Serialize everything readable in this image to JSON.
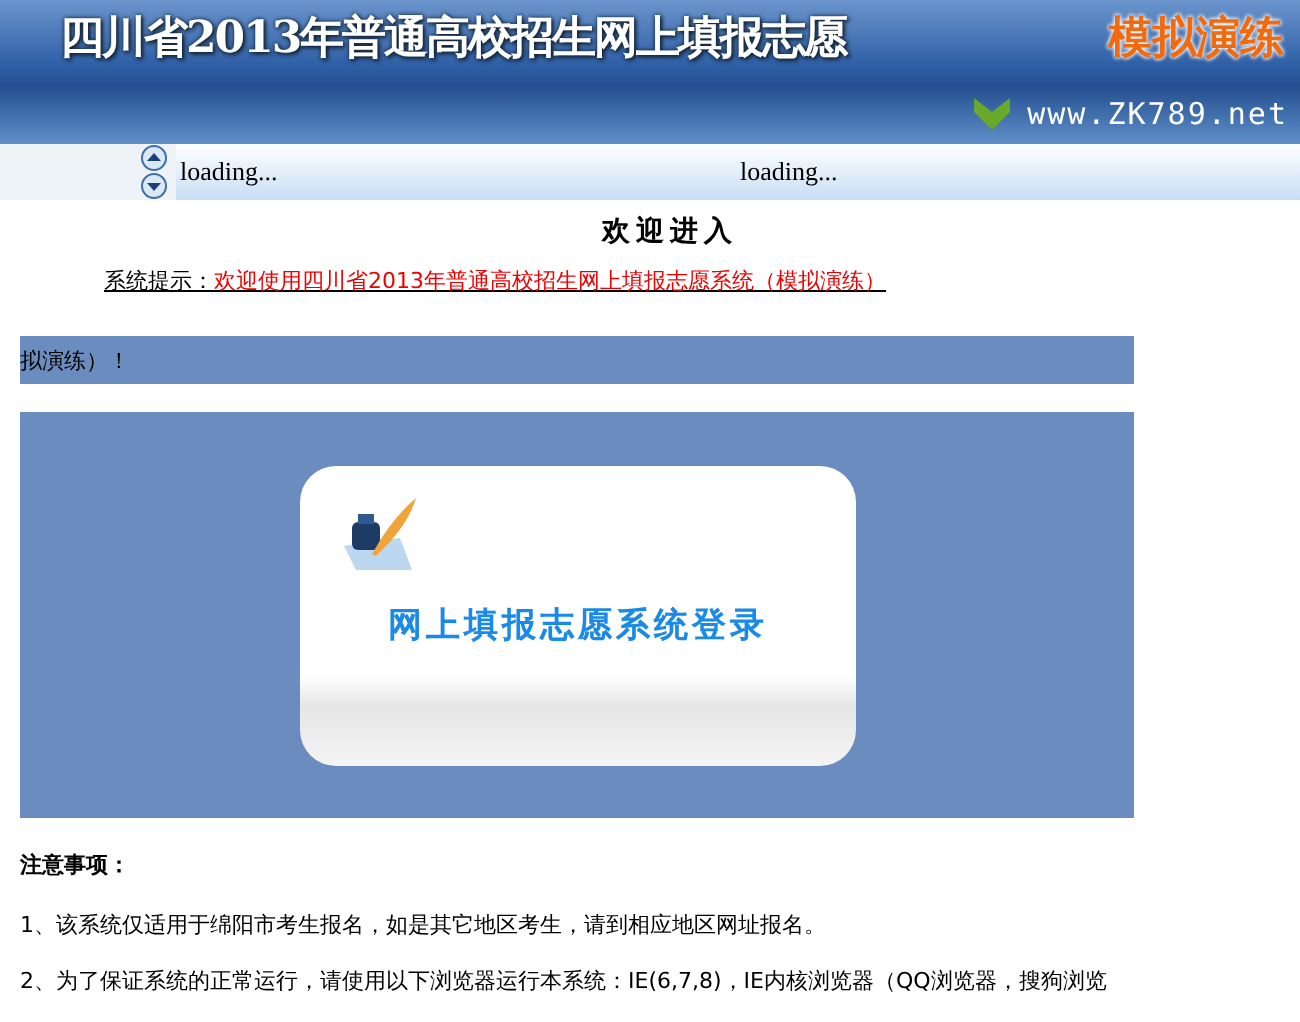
{
  "header": {
    "title": "四川省2013年普通高校招生网上填报志愿",
    "badge": "模拟演练",
    "site": "www.ZK789.net"
  },
  "loading_bar": {
    "items": [
      "loading...",
      "loading..."
    ]
  },
  "welcome": "欢迎进入",
  "notice": {
    "label": "系统提示：",
    "message": "欢迎使用四川省2013年普通高校招生网上填报志愿系统（模拟演练）"
  },
  "marquee": "拟演练）！",
  "login_card": {
    "label": "网上填报志愿系统登录"
  },
  "notes": {
    "heading": "注意事项：",
    "items": [
      "1、该系统仅适用于绵阳市考生报名，如是其它地区考生，请到相应地区网址报名。",
      "2、为了保证系统的正常运行，请使用以下浏览器运行本系统：IE(6,7,8)，IE内核浏览器（QQ浏览器，搜狗浏览"
    ]
  }
}
